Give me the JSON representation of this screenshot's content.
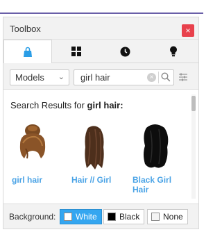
{
  "window": {
    "title": "Toolbox",
    "close_glyph": "×"
  },
  "tabs": [
    {
      "name": "marketplace",
      "icon": "shopping-bag-icon",
      "active": true
    },
    {
      "name": "inventory",
      "icon": "grid-icon",
      "active": false
    },
    {
      "name": "recent",
      "icon": "clock-icon",
      "active": false
    },
    {
      "name": "creations",
      "icon": "lightbulb-icon",
      "active": false
    }
  ],
  "toolbar": {
    "category": "Models",
    "search_value": "girl hair",
    "clear_glyph": "×"
  },
  "results": {
    "prefix": "Search Results for ",
    "query": "girl hair:",
    "items": [
      {
        "label": "girl hair",
        "style": "brown-bun"
      },
      {
        "label": "Hair // Girl",
        "style": "brown-long"
      },
      {
        "label": "Black Girl Hair",
        "style": "black-long"
      }
    ]
  },
  "background": {
    "label": "Background:",
    "options": [
      {
        "label": "White",
        "swatch": "#ffffff",
        "selected": true
      },
      {
        "label": "Black",
        "swatch": "#000000",
        "selected": false
      },
      {
        "label": "None",
        "swatch": "none",
        "selected": false
      }
    ]
  },
  "colors": {
    "accent_blue": "#34a6f0",
    "link_blue": "#4aa3e6",
    "close_red": "#e8414c",
    "bag_blue": "#2a9de6"
  }
}
